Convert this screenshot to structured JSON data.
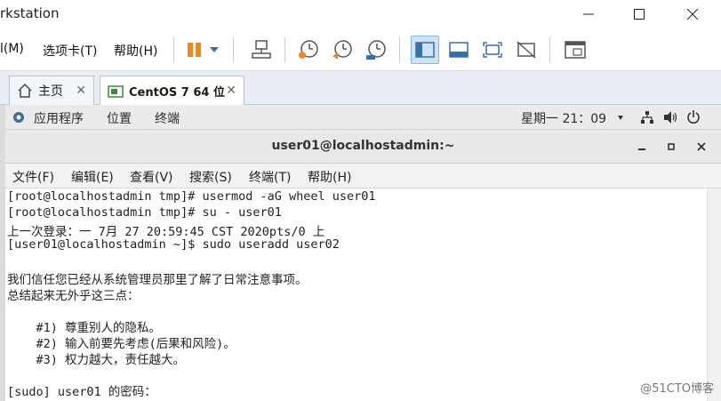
{
  "window": {
    "title": "rkstation"
  },
  "vmware": {
    "menu": [
      {
        "label": "l(M)"
      },
      {
        "label": "选项卡(T)"
      },
      {
        "label": "帮助(H)"
      }
    ],
    "tabs": [
      {
        "label": "主页",
        "close": "✕"
      },
      {
        "label": "CentOS 7 64 位",
        "close": "✕"
      }
    ]
  },
  "gnome": {
    "applications": "应用程序",
    "places": "位置",
    "terminal": "终端",
    "clock": "星期一 21：09"
  },
  "terminal": {
    "title": "user01@localhostadmin:~",
    "menu": [
      {
        "label": "文件(F)"
      },
      {
        "label": "编辑(E)"
      },
      {
        "label": "查看(V)"
      },
      {
        "label": "搜索(S)"
      },
      {
        "label": "终端(T)"
      },
      {
        "label": "帮助(H)"
      }
    ],
    "lines": [
      "[root@localhostadmin tmp]# usermod -aG wheel user01",
      "[root@localhostadmin tmp]# su - user01",
      "上一次登录：一 7月 27 20:59:45 CST 2020pts/0 上",
      "[user01@localhostadmin ~]$ sudo useradd user02",
      "",
      "我们信任您已经从系统管理员那里了解了日常注意事项。",
      "总结起来无外乎这三点：",
      "",
      "    #1) 尊重别人的隐私。",
      "    #2) 输入前要先考虑(后果和风险)。",
      "    #3) 权力越大，责任越大。",
      "",
      "[sudo] user01 的密码："
    ]
  },
  "watermark": "@51CTO博客",
  "colors": {
    "active_tool_bg": "#cfe3f7",
    "pause_orange": "#e8892b",
    "tool_blue": "#3a6ea5"
  }
}
